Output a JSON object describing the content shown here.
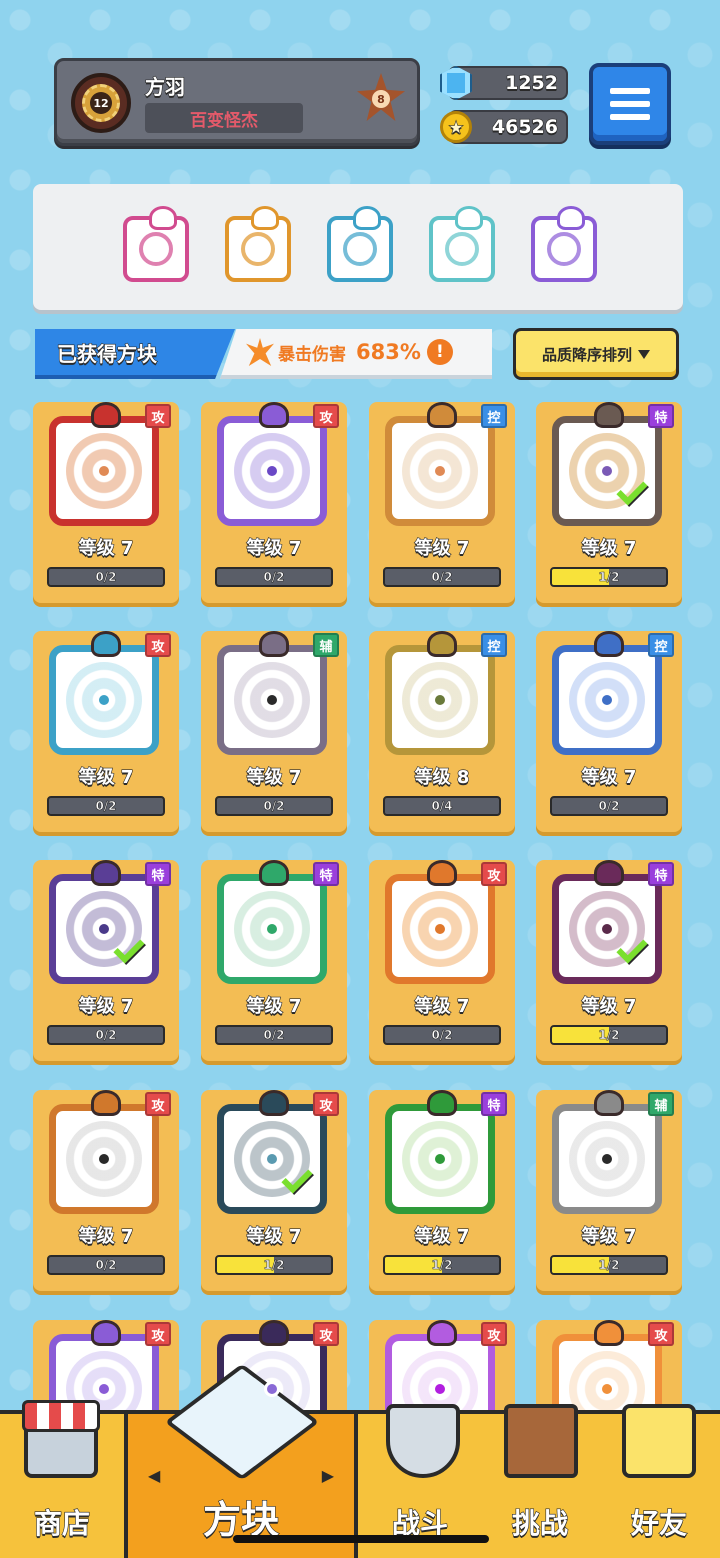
{
  "profile": {
    "name": "方羽",
    "title": "百变怪杰",
    "avatar_level": "12",
    "rank_badge": "8",
    "avatar_icon": "gear-emblem"
  },
  "currency": {
    "gems": "1252",
    "coins": "46526"
  },
  "equipped_slots": [
    {
      "icon": "crossed-swords",
      "color": "#d14b8f"
    },
    {
      "icon": "infinity",
      "color": "#e0962c"
    },
    {
      "icon": "vortex",
      "color": "#3ca1c7"
    },
    {
      "icon": "hands-orb",
      "color": "#5fc3c8"
    },
    {
      "icon": "arrow-orb",
      "color": "#8a5cd6"
    }
  ],
  "banner": {
    "owned_label": "已获得方块",
    "crit_label": "暴击伤害",
    "crit_value": "683%",
    "info_symbol": "!",
    "sort_label": "品质降序排列"
  },
  "cubes": [
    {
      "tag": "攻",
      "tag_type": "atk",
      "level": "等级 7",
      "progress": "0/2",
      "progress_fraction": 0,
      "color": "#c8322e",
      "pattern": "#e08a55",
      "dot": "#e08a55",
      "equipped": false
    },
    {
      "tag": "攻",
      "tag_type": "atk",
      "level": "等级 7",
      "progress": "0/2",
      "progress_fraction": 0,
      "color": "#8a5cd6",
      "pattern": "#a48ee0",
      "dot": "#6a48c6",
      "equipped": false
    },
    {
      "tag": "控",
      "tag_type": "ctl",
      "level": "等级 7",
      "progress": "0/2",
      "progress_fraction": 0,
      "color": "#d08b3a",
      "pattern": "#e7c8a1",
      "dot": "#e08a55",
      "equipped": false
    },
    {
      "tag": "特",
      "tag_type": "spc",
      "level": "等级 7",
      "progress": "1/2",
      "progress_fraction": 0.5,
      "color": "#6a5a52",
      "pattern": "#d59a4a",
      "dot": "#7a5ab6",
      "equipped": true
    },
    {
      "tag": "攻",
      "tag_type": "atk",
      "level": "等级 7",
      "progress": "0/2",
      "progress_fraction": 0,
      "color": "#3ca1c7",
      "pattern": "#9fd8e8",
      "dot": "#3ca1c7",
      "equipped": false
    },
    {
      "tag": "辅",
      "tag_type": "sup",
      "level": "等级 7",
      "progress": "0/2",
      "progress_fraction": 0,
      "color": "#7a6e86",
      "pattern": "#bdb4c6",
      "dot": "#2a2a2a",
      "equipped": false
    },
    {
      "tag": "控",
      "tag_type": "ctl",
      "level": "等级 8",
      "progress": "0/4",
      "progress_fraction": 0,
      "color": "#b5963a",
      "pattern": "#d8cfa5",
      "dot": "#6a7a3a",
      "equipped": false
    },
    {
      "tag": "控",
      "tag_type": "ctl",
      "level": "等级 7",
      "progress": "0/2",
      "progress_fraction": 0,
      "color": "#3f6fc6",
      "pattern": "#9ab8ef",
      "dot": "#3f6fc6",
      "equipped": false
    },
    {
      "tag": "特",
      "tag_type": "spc",
      "level": "等级 7",
      "progress": "0/2",
      "progress_fraction": 0,
      "color": "#5a3e96",
      "pattern": "#7a6aa6",
      "dot": "#4a3a8a",
      "equipped": true
    },
    {
      "tag": "特",
      "tag_type": "spc",
      "level": "等级 7",
      "progress": "0/2",
      "progress_fraction": 0,
      "color": "#2fa86a",
      "pattern": "#a9d9bd",
      "dot": "#2fa86a",
      "equipped": false
    },
    {
      "tag": "攻",
      "tag_type": "atk",
      "level": "等级 7",
      "progress": "0/2",
      "progress_fraction": 0,
      "color": "#e0782c",
      "pattern": "#f0a050",
      "dot": "#e0782c",
      "equipped": false
    },
    {
      "tag": "特",
      "tag_type": "spc",
      "level": "等级 7",
      "progress": "1/2",
      "progress_fraction": 0.5,
      "color": "#6a2a5a",
      "pattern": "#a06a8a",
      "dot": "#5a2a4a",
      "equipped": true
    },
    {
      "tag": "攻",
      "tag_type": "atk",
      "level": "等级 7",
      "progress": "0/2",
      "progress_fraction": 0,
      "color": "#d0782c",
      "pattern": "#c9c9c9",
      "dot": "#2a2a2a",
      "equipped": false
    },
    {
      "tag": "攻",
      "tag_type": "atk",
      "level": "等级 7",
      "progress": "1/2",
      "progress_fraction": 0.5,
      "color": "#2a4a5a",
      "pattern": "#6a7e8a",
      "dot": "#5a9ab0",
      "equipped": true
    },
    {
      "tag": "特",
      "tag_type": "spc",
      "level": "等级 7",
      "progress": "1/2",
      "progress_fraction": 0.5,
      "color": "#2f9a3a",
      "pattern": "#b8e0a5",
      "dot": "#2f9a3a",
      "equipped": false
    },
    {
      "tag": "辅",
      "tag_type": "sup",
      "level": "等级 7",
      "progress": "1/2",
      "progress_fraction": 0.5,
      "color": "#8a8a8a",
      "pattern": "#cfcfcf",
      "dot": "#2a2a2a",
      "equipped": false
    },
    {
      "tag": "攻",
      "tag_type": "atk",
      "level": "",
      "progress": "",
      "progress_fraction": 0,
      "color": "#8a5cd6",
      "pattern": "#c6b6ef",
      "dot": "#8a5cd6",
      "equipped": false
    },
    {
      "tag": "攻",
      "tag_type": "atk",
      "level": "",
      "progress": "",
      "progress_fraction": 0,
      "color": "#3a2a5a",
      "pattern": "#d6d0ef",
      "dot": "#8a6ad6",
      "equipped": false
    },
    {
      "tag": "攻",
      "tag_type": "atk",
      "level": "",
      "progress": "",
      "progress_fraction": 0,
      "color": "#b25ce0",
      "pattern": "#e6c6f5",
      "dot": "#b21ee0",
      "equipped": false
    },
    {
      "tag": "攻",
      "tag_type": "atk",
      "level": "",
      "progress": "",
      "progress_fraction": 0,
      "color": "#f0903a",
      "pattern": "#f8d2aa",
      "dot": "#f0903a",
      "equipped": false
    }
  ],
  "bottom_nav": [
    {
      "label": "商店",
      "icon": "shop-stall"
    },
    {
      "label": "方块",
      "icon": "mystery-cube",
      "active": true
    },
    {
      "label": "战斗",
      "icon": "shield-sword"
    },
    {
      "label": "挑战",
      "icon": "signboard"
    },
    {
      "label": "好友",
      "icon": "friend-cube"
    }
  ],
  "nav_arrows": {
    "left": "◀",
    "right": "▶"
  }
}
